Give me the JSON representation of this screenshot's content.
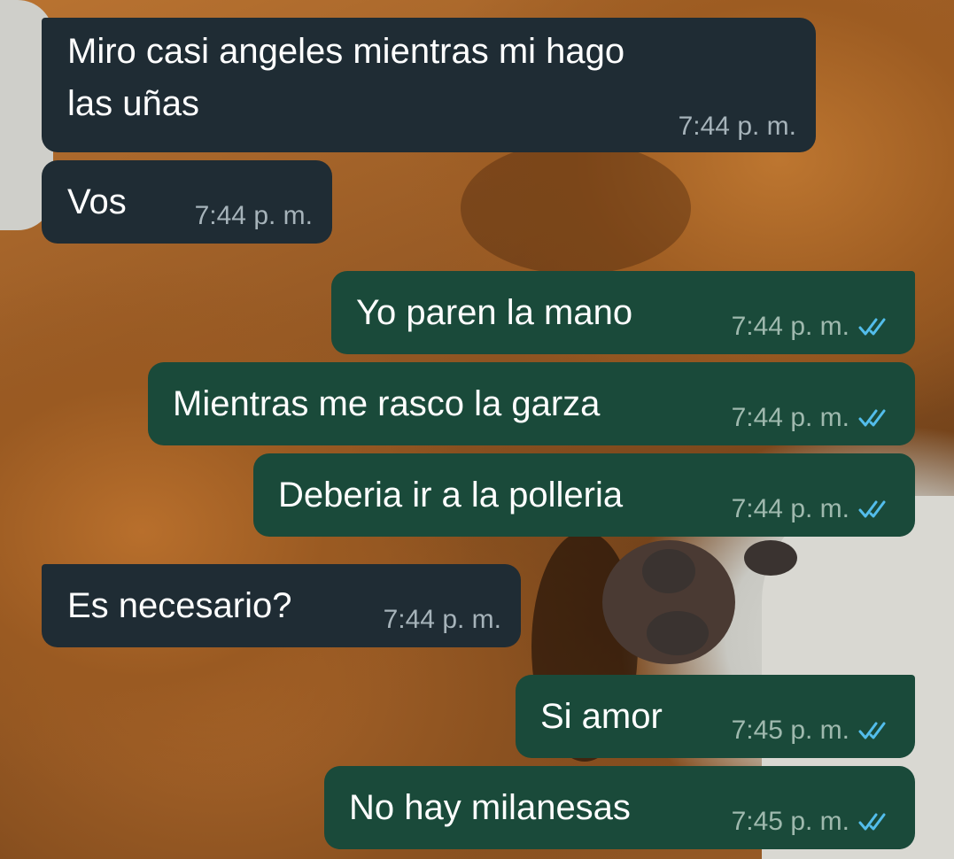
{
  "messages": [
    {
      "direction": "incoming",
      "lines": [
        "Miro casi angeles mientras mi hago",
        "las uñas"
      ],
      "time": "7:44 p. m."
    },
    {
      "direction": "incoming",
      "lines": [
        "Vos"
      ],
      "time": "7:44 p. m."
    },
    {
      "direction": "outgoing",
      "lines": [
        "Yo paren la mano"
      ],
      "time": "7:44 p. m.",
      "status": "read"
    },
    {
      "direction": "outgoing",
      "lines": [
        "Mientras me rasco la garza"
      ],
      "time": "7:44 p. m.",
      "status": "read"
    },
    {
      "direction": "outgoing",
      "lines": [
        "Deberia ir a la polleria"
      ],
      "time": "7:44 p. m.",
      "status": "read"
    },
    {
      "direction": "incoming",
      "lines": [
        "Es necesario?"
      ],
      "time": "7:44 p. m."
    },
    {
      "direction": "outgoing",
      "lines": [
        "Si amor"
      ],
      "time": "7:45 p. m.",
      "status": "read"
    },
    {
      "direction": "outgoing",
      "lines": [
        "No hay milanesas"
      ],
      "time": "7:45 p. m.",
      "status": "read"
    }
  ],
  "icons": {
    "read_receipt": "double-check-icon"
  },
  "colors": {
    "incoming_bubble": "#1f2c34",
    "outgoing_bubble": "#1a4a3a",
    "read_tick": "#53bdeb"
  }
}
